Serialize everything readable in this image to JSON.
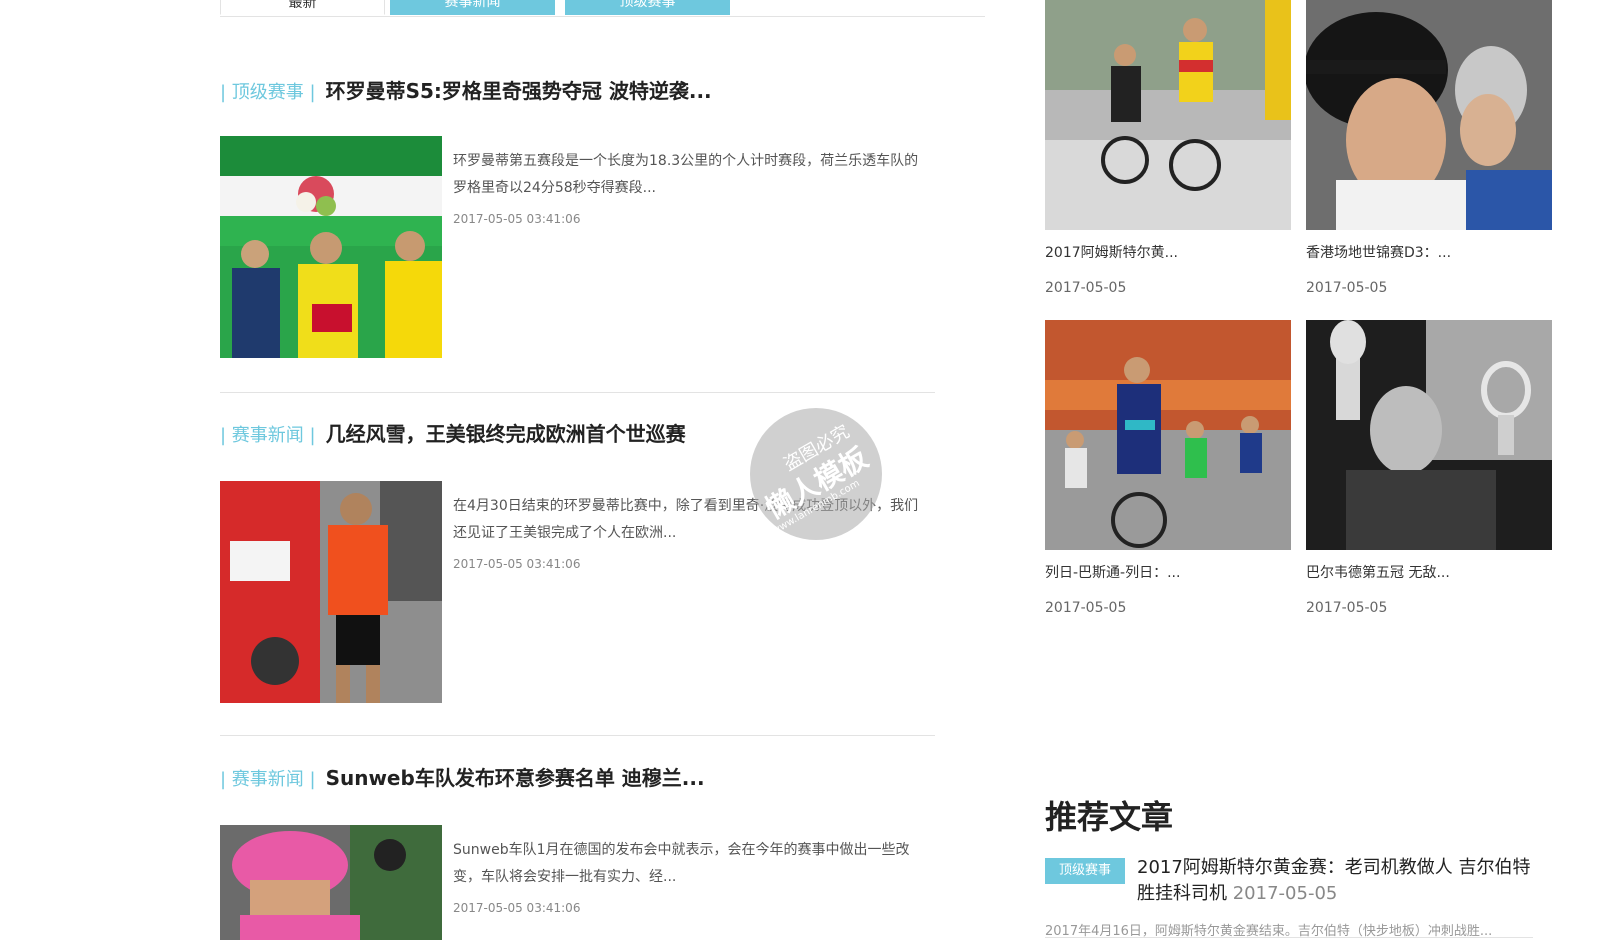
{
  "tabs": [
    {
      "label": "最新"
    },
    {
      "label": "赛事新闻"
    },
    {
      "label": "顶级赛事"
    }
  ],
  "articles": [
    {
      "category": "| 顶级赛事 |",
      "title": "环罗曼蒂S5:罗格里奇强势夺冠 波特逆袭...",
      "summary": "环罗曼蒂第五赛段是一个长度为18.3公里的个人计时赛段，荷兰乐透车队的罗格里奇以24分58秒夺得赛段...",
      "date": "2017-05-05 03:41:06"
    },
    {
      "category": "| 赛事新闻 |",
      "title": "几经风雪，王美银终完成欧洲首个世巡赛",
      "summary": "在4月30日结束的环罗曼蒂比赛中，除了看到里奇·波特成功登顶以外，我们还见证了王美银完成了个人在欧洲...",
      "date": "2017-05-05 03:41:06"
    },
    {
      "category": "| 赛事新闻 |",
      "title": "Sunweb车队发布环意参赛名单 迪穆兰...",
      "summary": "Sunweb车队1月在德国的发布会中就表示，会在今年的赛事中做出一些改变，车队将会安排一批有实力、经...",
      "date": "2017-05-05 03:41:06"
    }
  ],
  "grid": [
    {
      "title": "2017阿姆斯特尔黄...",
      "date": "2017-05-05"
    },
    {
      "title": "香港场地世锦赛D3：...",
      "date": "2017-05-05"
    },
    {
      "title": "列日-巴斯通-列日：...",
      "date": "2017-05-05"
    },
    {
      "title": "巴尔韦德第五冠 无敌...",
      "date": "2017-05-05"
    }
  ],
  "recommended": {
    "heading": "推荐文章",
    "badge": "顶级赛事",
    "title": "2017阿姆斯特尔黄金赛：老司机教做人 吉尔伯特胜挂科司机",
    "date": "2017-05-05",
    "excerpt": "2017年4月16日，阿姆斯特尔黄金赛结束。吉尔伯特（快步地板）冲刺战胜..."
  },
  "watermark": {
    "line1": "盗图必究",
    "line2": "懒人模板",
    "line3": "www.lanrenmb.com"
  },
  "colors": {
    "accent": "#6ec8de"
  }
}
